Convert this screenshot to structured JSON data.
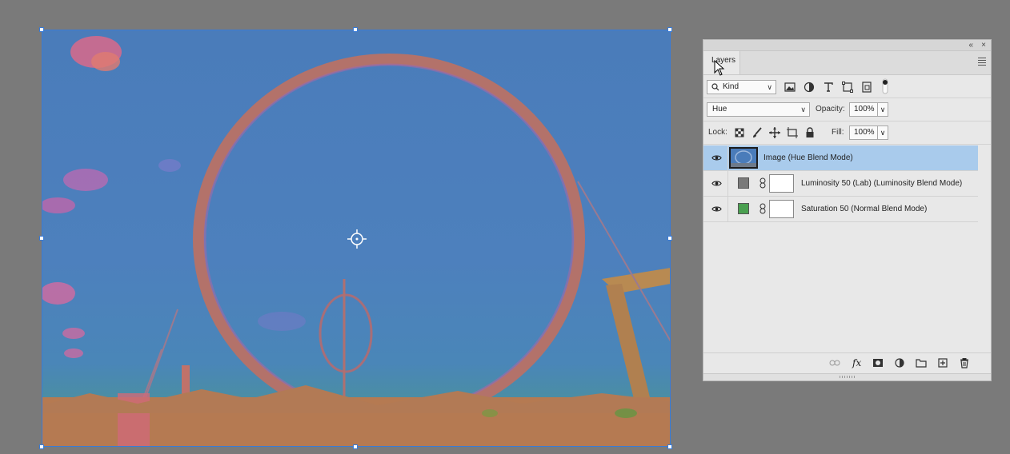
{
  "panel": {
    "tab_label": "Layers",
    "filter_kind": "Kind",
    "blend_mode": "Hue",
    "opacity_label": "Opacity:",
    "opacity_value": "100%",
    "lock_label": "Lock:",
    "fill_label": "Fill:",
    "fill_value": "100%",
    "collapse_glyph": "«",
    "close_glyph": "×"
  },
  "layers": [
    {
      "name": "Image (Hue Blend Mode)",
      "selected": true,
      "swatch": null
    },
    {
      "name": "Luminosity 50 (Lab) (Luminosity Blend Mode)",
      "selected": false,
      "swatch": "#7a7a7a"
    },
    {
      "name": "Saturation 50  (Normal Blend Mode)",
      "selected": false,
      "swatch": "#4aa050"
    }
  ],
  "colors": {
    "selection": "#a9cbec",
    "bbox": "#3a7bd5",
    "workspace": "#7a7a7a"
  },
  "icons": {
    "filter": [
      "image-filter-icon",
      "adjustment-filter-icon",
      "type-filter-icon",
      "shape-filter-icon",
      "smart-object-filter-icon",
      "filter-toggle-icon"
    ],
    "lock": [
      "lock-transparent-icon",
      "lock-paint-icon",
      "lock-position-icon",
      "lock-artboard-icon",
      "lock-all-icon"
    ],
    "footer": [
      "link-layers-icon",
      "fx-icon",
      "add-mask-icon",
      "adjustment-layer-icon",
      "new-group-icon",
      "new-layer-icon",
      "delete-layer-icon"
    ]
  }
}
